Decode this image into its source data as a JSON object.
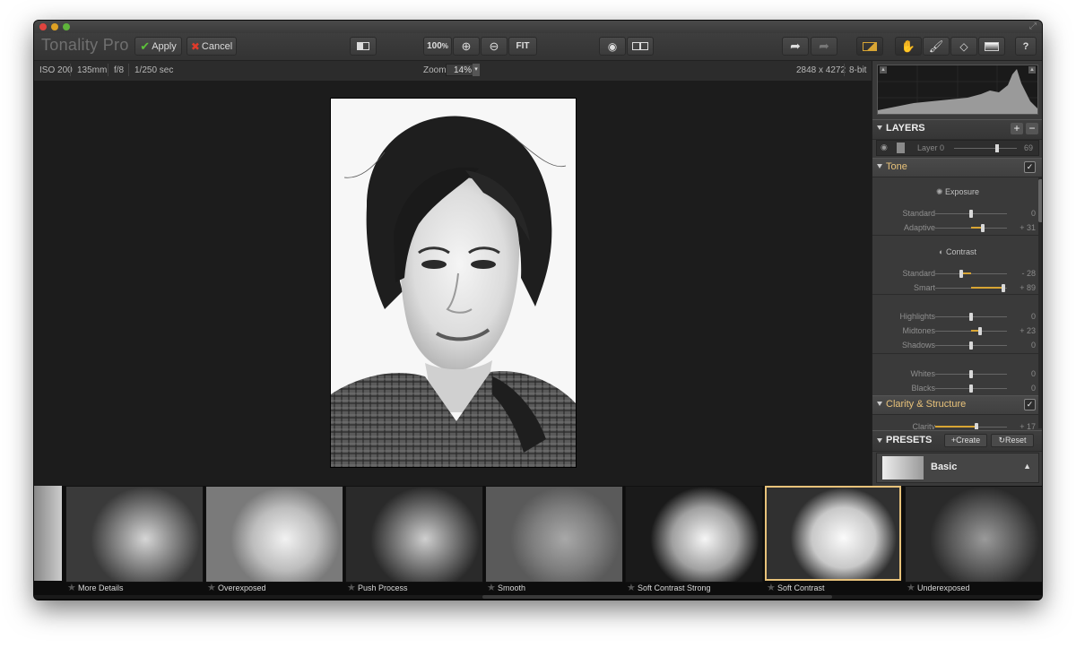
{
  "app": {
    "name": "Tonality Pro"
  },
  "toolbar": {
    "apply": "Apply",
    "cancel": "Cancel",
    "zoom_100": "100",
    "zoom_100_suffix": "%",
    "fit": "FIT",
    "help": "?"
  },
  "info": {
    "iso": "ISO 200",
    "focal": "135mm",
    "aperture": "f/8",
    "shutter": "1/250 sec",
    "zoom_label": "Zoom",
    "zoom_value": "14%",
    "dimensions": "2848 x 4272",
    "bitdepth": "8-bit"
  },
  "layers": {
    "title": "LAYERS",
    "layer_name": "Layer 0",
    "opacity": "69",
    "opacity_level": 0.69
  },
  "tone": {
    "title": "Tone",
    "exposure_title": "Exposure",
    "contrast_title": "Contrast",
    "rows": [
      {
        "label": "Standard",
        "value": "0",
        "level": 0.5
      },
      {
        "label": "Adaptive",
        "value": "+ 31",
        "level": 0.66
      },
      {
        "label": "Standard",
        "value": "- 28",
        "level": 0.36
      },
      {
        "label": "Smart",
        "value": "+ 89",
        "level": 0.95
      },
      {
        "label": "Highlights",
        "value": "0",
        "level": 0.5
      },
      {
        "label": "Midtones",
        "value": "+ 23",
        "level": 0.62
      },
      {
        "label": "Shadows",
        "value": "0",
        "level": 0.5
      },
      {
        "label": "Whites",
        "value": "0",
        "level": 0.5
      },
      {
        "label": "Blacks",
        "value": "0",
        "level": 0.5
      }
    ]
  },
  "clarity": {
    "title": "Clarity & Structure",
    "row_label": "Clarity",
    "row_value": "+ 17",
    "level": 0.58
  },
  "presets": {
    "title": "PRESETS",
    "create": "Create",
    "reset": "Reset",
    "current": "Basic"
  },
  "filmstrip": [
    {
      "label": "More Details"
    },
    {
      "label": "Overexposed"
    },
    {
      "label": "Push Process"
    },
    {
      "label": "Smooth"
    },
    {
      "label": "Soft Contrast Strong"
    },
    {
      "label": "Soft Contrast"
    },
    {
      "label": "Underexposed"
    }
  ],
  "colors": {
    "accent": "#d8a534",
    "apply_check": "#5cc23a",
    "cancel_x": "#e03a2a",
    "selected_thumb": "#e8c27a"
  }
}
